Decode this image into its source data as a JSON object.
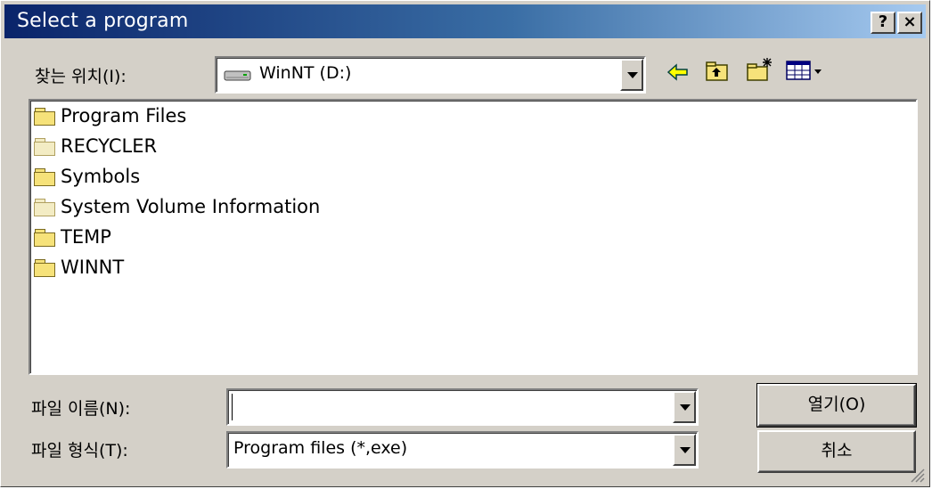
{
  "window": {
    "title": "Select a program",
    "help_label": "?",
    "close_label": "×"
  },
  "lookin": {
    "label": "찾는 위치(I):",
    "value": "WinNT (D:)"
  },
  "toolbar": {
    "icons": [
      "back-arrow-icon",
      "up-one-level-icon",
      "new-folder-icon",
      "view-menu-icon"
    ]
  },
  "files": [
    {
      "name": "Program Files",
      "icon": "folder-icon"
    },
    {
      "name": "RECYCLER",
      "icon": "folder-icon"
    },
    {
      "name": "Symbols",
      "icon": "folder-icon"
    },
    {
      "name": "System Volume Information",
      "icon": "folder-icon"
    },
    {
      "name": "TEMP",
      "icon": "folder-icon"
    },
    {
      "name": "WINNT",
      "icon": "folder-icon"
    }
  ],
  "filename": {
    "label": "파일 이름(N):",
    "value": "",
    "placeholder": ""
  },
  "filetype": {
    "label": "파일 형식(T):",
    "value": "Program files (*,exe)"
  },
  "buttons": {
    "open_label": "열기(O)",
    "cancel_label": "취소"
  },
  "colors": {
    "title_start": "#0a246a",
    "title_end": "#a6caf0",
    "face": "#d4d0c8",
    "folder_yellow": "#f6e27a",
    "folder_pale": "#f3ecc4"
  }
}
